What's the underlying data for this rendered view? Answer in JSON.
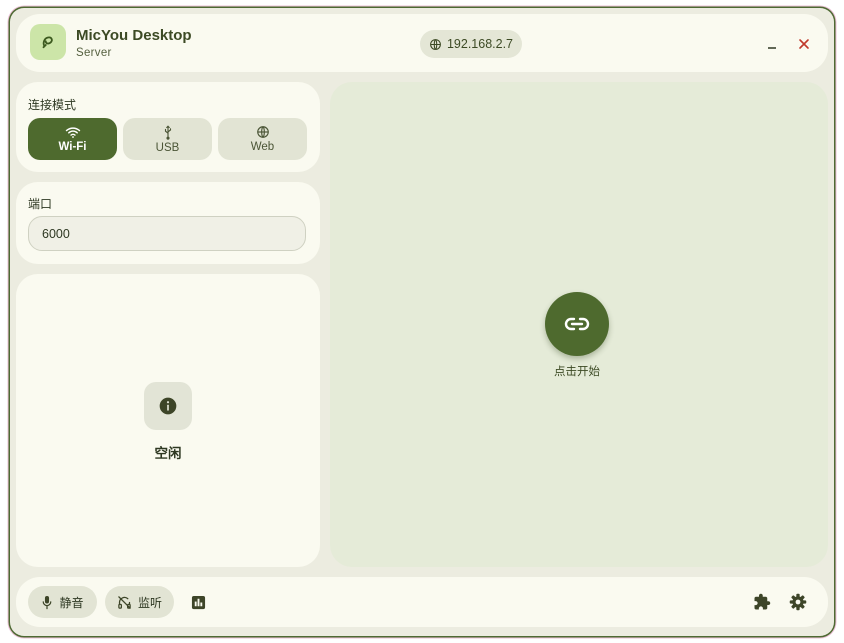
{
  "app": {
    "title": "MicYou Desktop",
    "subtitle": "Server"
  },
  "header": {
    "ip_address": "192.168.2.7"
  },
  "connection": {
    "label": "连接模式",
    "modes": [
      {
        "label": "Wi-Fi",
        "icon": "wifi-icon",
        "active": true
      },
      {
        "label": "USB",
        "icon": "usb-icon",
        "active": false
      },
      {
        "label": "Web",
        "icon": "globe-icon",
        "active": false
      }
    ]
  },
  "port": {
    "label": "端口",
    "value": "6000"
  },
  "status": {
    "text": "空闲",
    "icon": "info-icon"
  },
  "main": {
    "start_label": "点击开始",
    "icon": "link-icon"
  },
  "bottom": {
    "mute_label": "静音",
    "monitor_label": "监听"
  },
  "colors": {
    "accent": "#4e6a2e",
    "background": "#ecece0",
    "card": "#fafaf0",
    "panel": "#e5ebd8",
    "close": "#c0392b"
  }
}
